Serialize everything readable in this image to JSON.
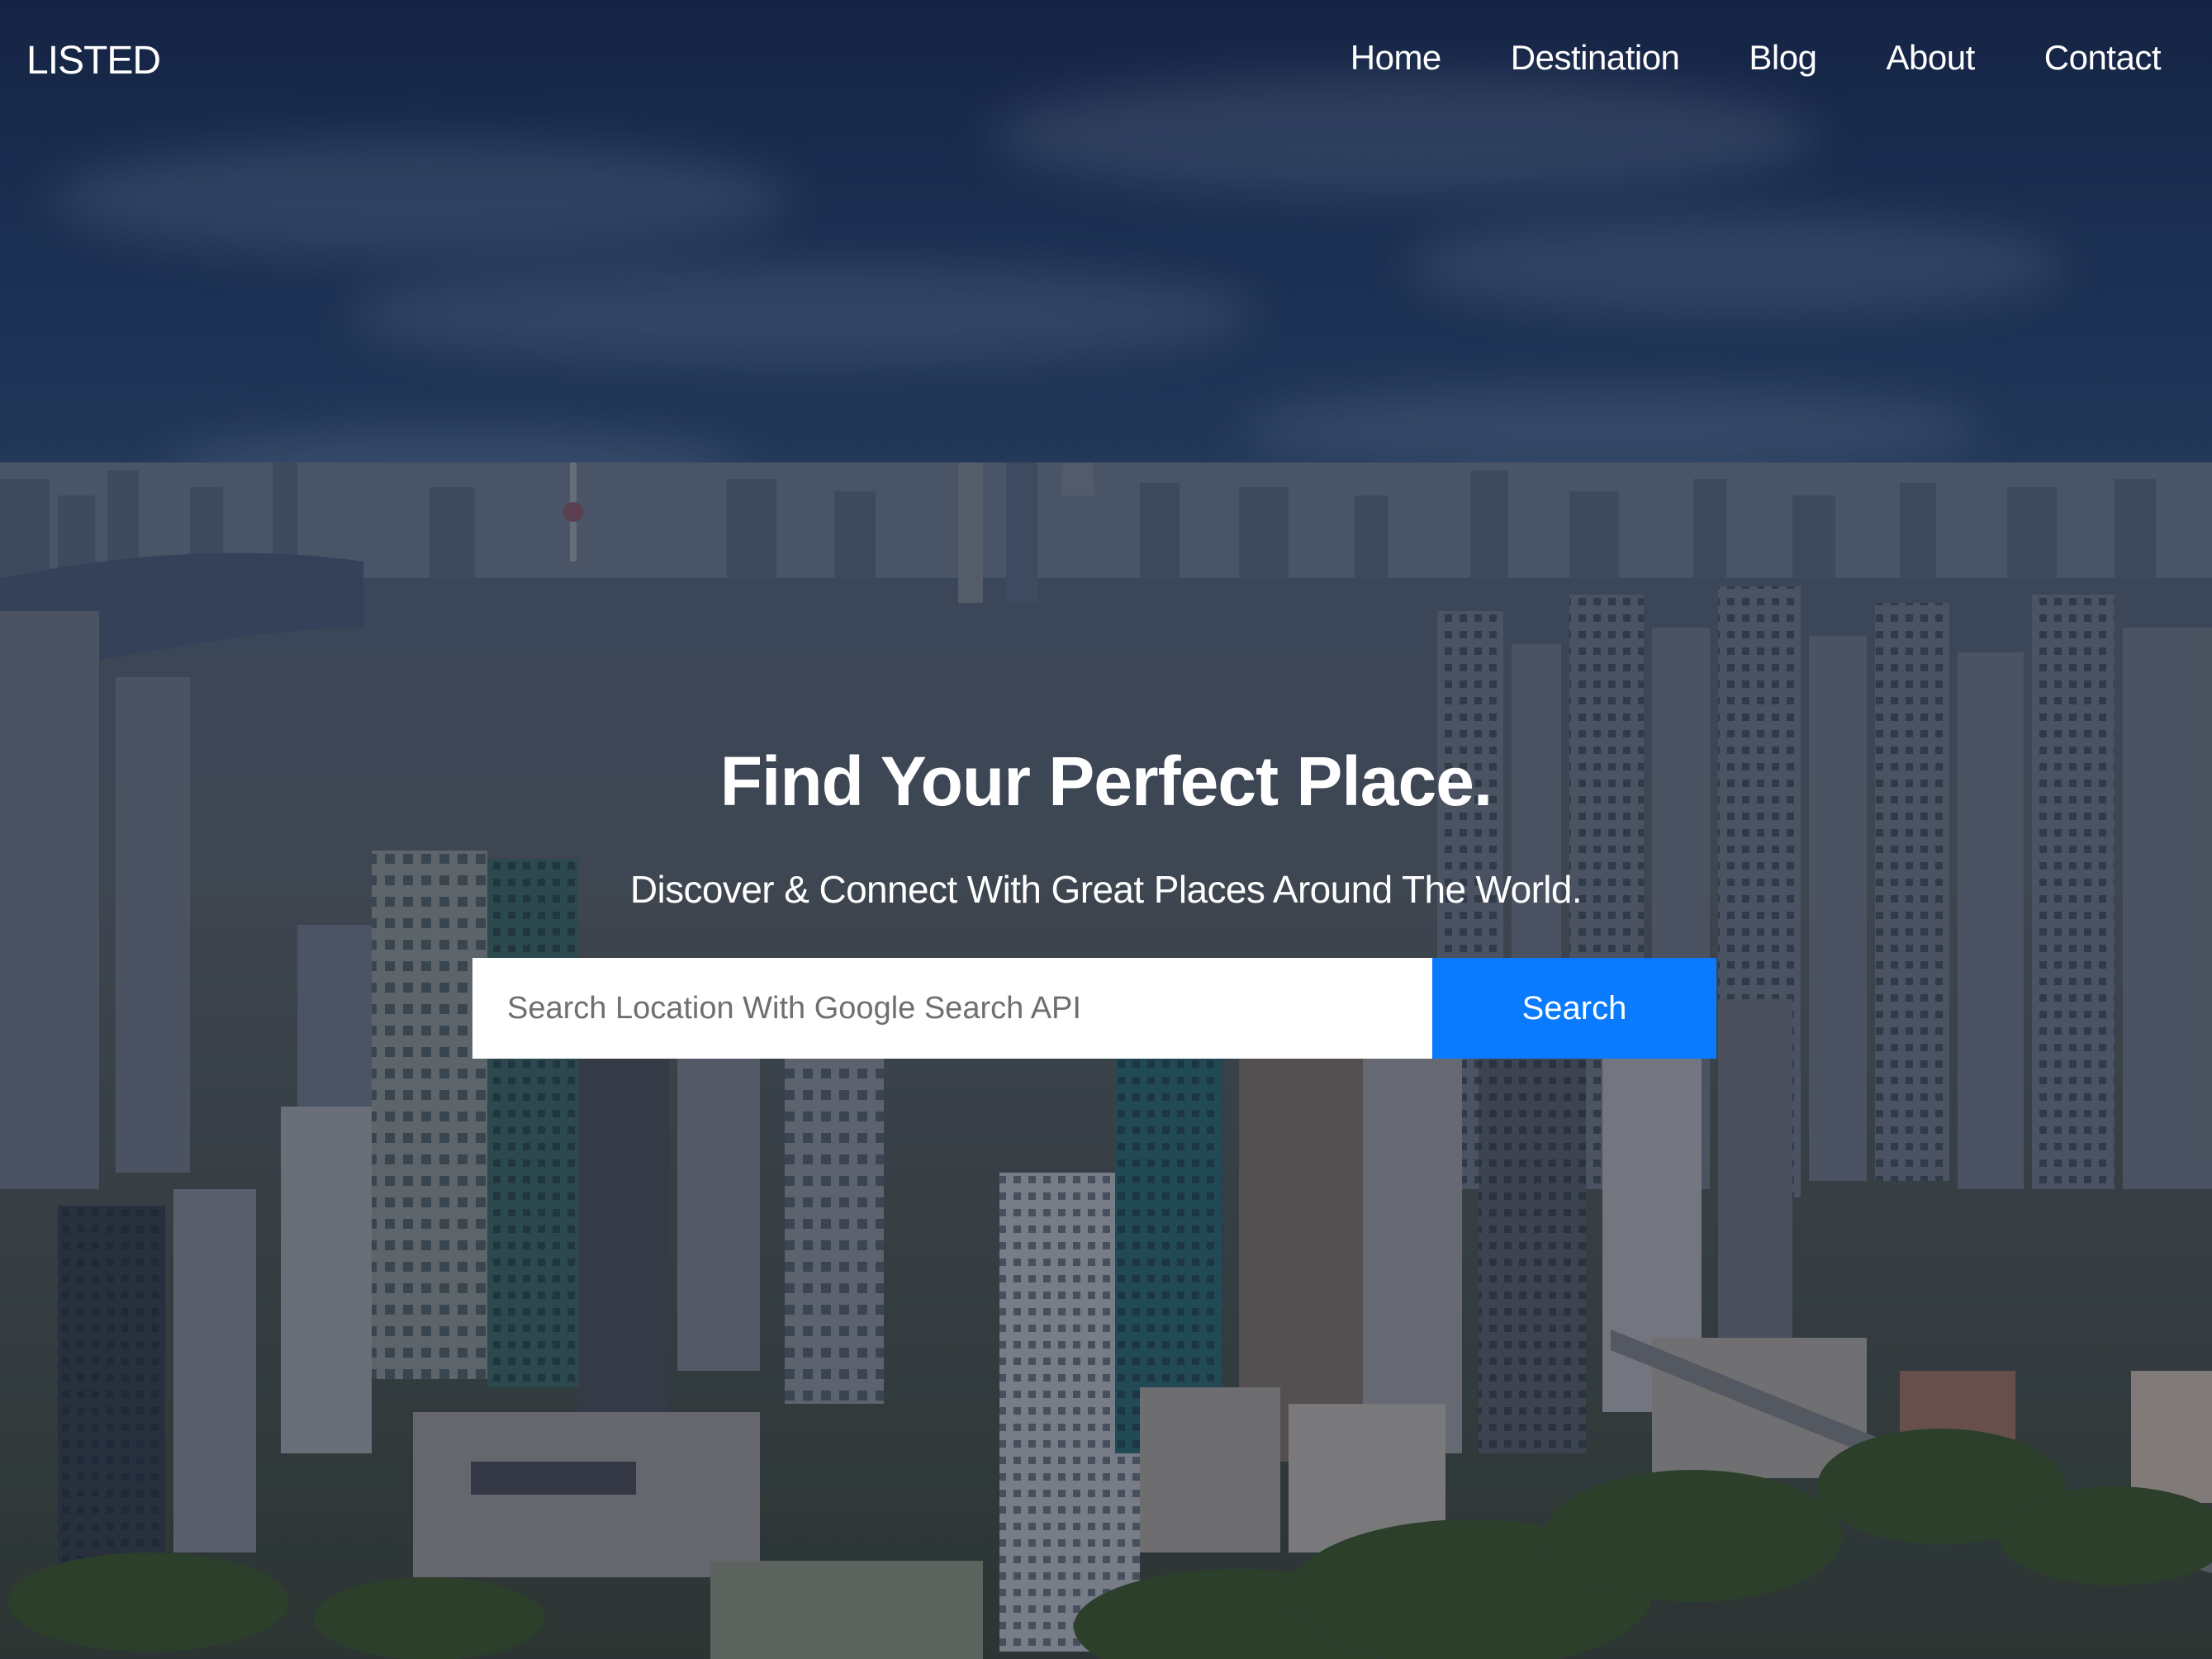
{
  "brand": {
    "logo": "LISTED"
  },
  "nav": {
    "items": [
      {
        "label": "Home"
      },
      {
        "label": "Destination"
      },
      {
        "label": "Blog"
      },
      {
        "label": "About"
      },
      {
        "label": "Contact"
      }
    ]
  },
  "hero": {
    "title": "Find Your Perfect Place.",
    "subtitle": "Discover & Connect With Great Places Around The World.",
    "background": "city-skyline-image"
  },
  "search": {
    "placeholder": "Search Location With Google Search API",
    "value": "",
    "button_label": "Search"
  },
  "colors": {
    "accent": "#0a7bff",
    "text": "#ffffff",
    "overlay": "#0a1226"
  }
}
